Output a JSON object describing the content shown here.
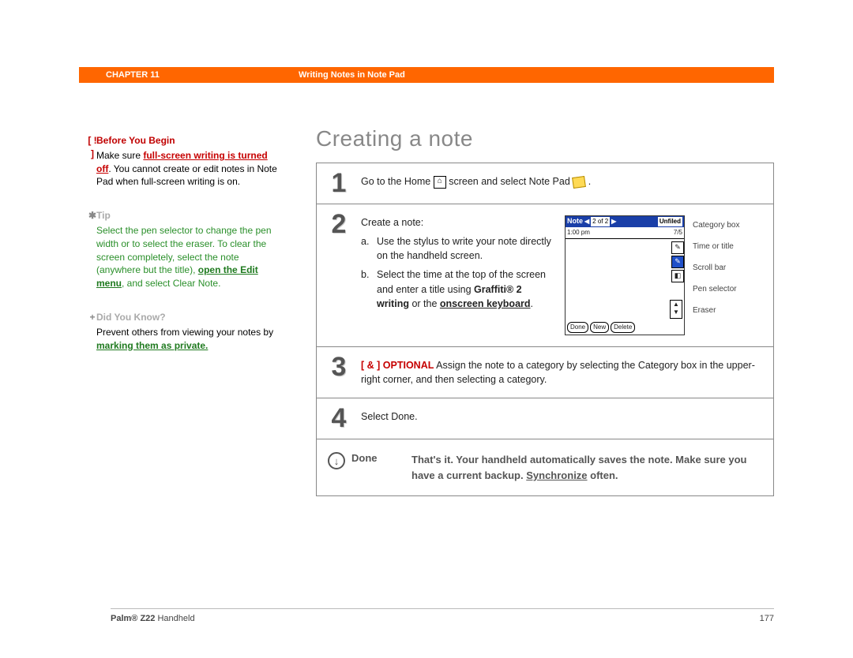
{
  "header": {
    "chapter": "CHAPTER 11",
    "title": "Writing Notes in Note Pad"
  },
  "sidebar": {
    "before_begin": {
      "icon": "[ ! ]",
      "heading": "Before You Begin",
      "body_pre": "Make sure ",
      "link": "full-screen writing is turned off",
      "body_post": ". You cannot create or edit notes in Note Pad when full-screen writing is on."
    },
    "tip": {
      "icon": "✱",
      "heading": "Tip",
      "body_pre": "Select the pen selector to change the pen width or to select the eraser. To clear the screen completely, select the note (anywhere but the title), ",
      "link": "open the Edit menu",
      "body_post": ", and select Clear Note."
    },
    "dyk": {
      "icon": "+",
      "heading": "Did You Know?",
      "body_pre": "Prevent others from viewing your notes by ",
      "link": "marking them as private.",
      "body_post": ""
    }
  },
  "main": {
    "title": "Creating a note",
    "step1": {
      "num": "1",
      "pre": "Go to the Home ",
      "mid": " screen and select Note Pad ",
      "post": "."
    },
    "step2": {
      "num": "2",
      "intro": "Create a note:",
      "a_marker": "a.",
      "a": "Use the stylus to write your note directly on the handheld screen.",
      "b_marker": "b.",
      "b_pre": "Select the time at the top of the screen and enter a title using ",
      "b_link1": "Graffiti® 2 writing",
      "b_mid": " or the ",
      "b_link2": "onscreen keyboard",
      "b_post": "."
    },
    "step3": {
      "num": "3",
      "tag": "[ & ]  OPTIONAL",
      "text": "   Assign the note to a category by selecting the Category box in the upper-right corner, and then selecting a category."
    },
    "step4": {
      "num": "4",
      "text": "Select Done."
    },
    "done": {
      "label": "Done",
      "text_pre": "That's it. Your handheld automatically saves the note. Make sure you have a current backup. ",
      "sync": "Synchronize",
      "text_post": " often."
    },
    "device": {
      "title": "Note",
      "pager": "2 of 2",
      "category": "Unfiled",
      "time": "1:00 pm",
      "date": "7/5",
      "btn_done": "Done",
      "btn_new": "New",
      "btn_delete": "Delete"
    },
    "labels": {
      "category": "Category box",
      "time": "Time or title",
      "scroll": "Scroll bar",
      "pen": "Pen selector",
      "eraser": "Eraser"
    }
  },
  "footer": {
    "product_bold": "Palm® Z22",
    "product_rest": " Handheld",
    "page": "177"
  }
}
